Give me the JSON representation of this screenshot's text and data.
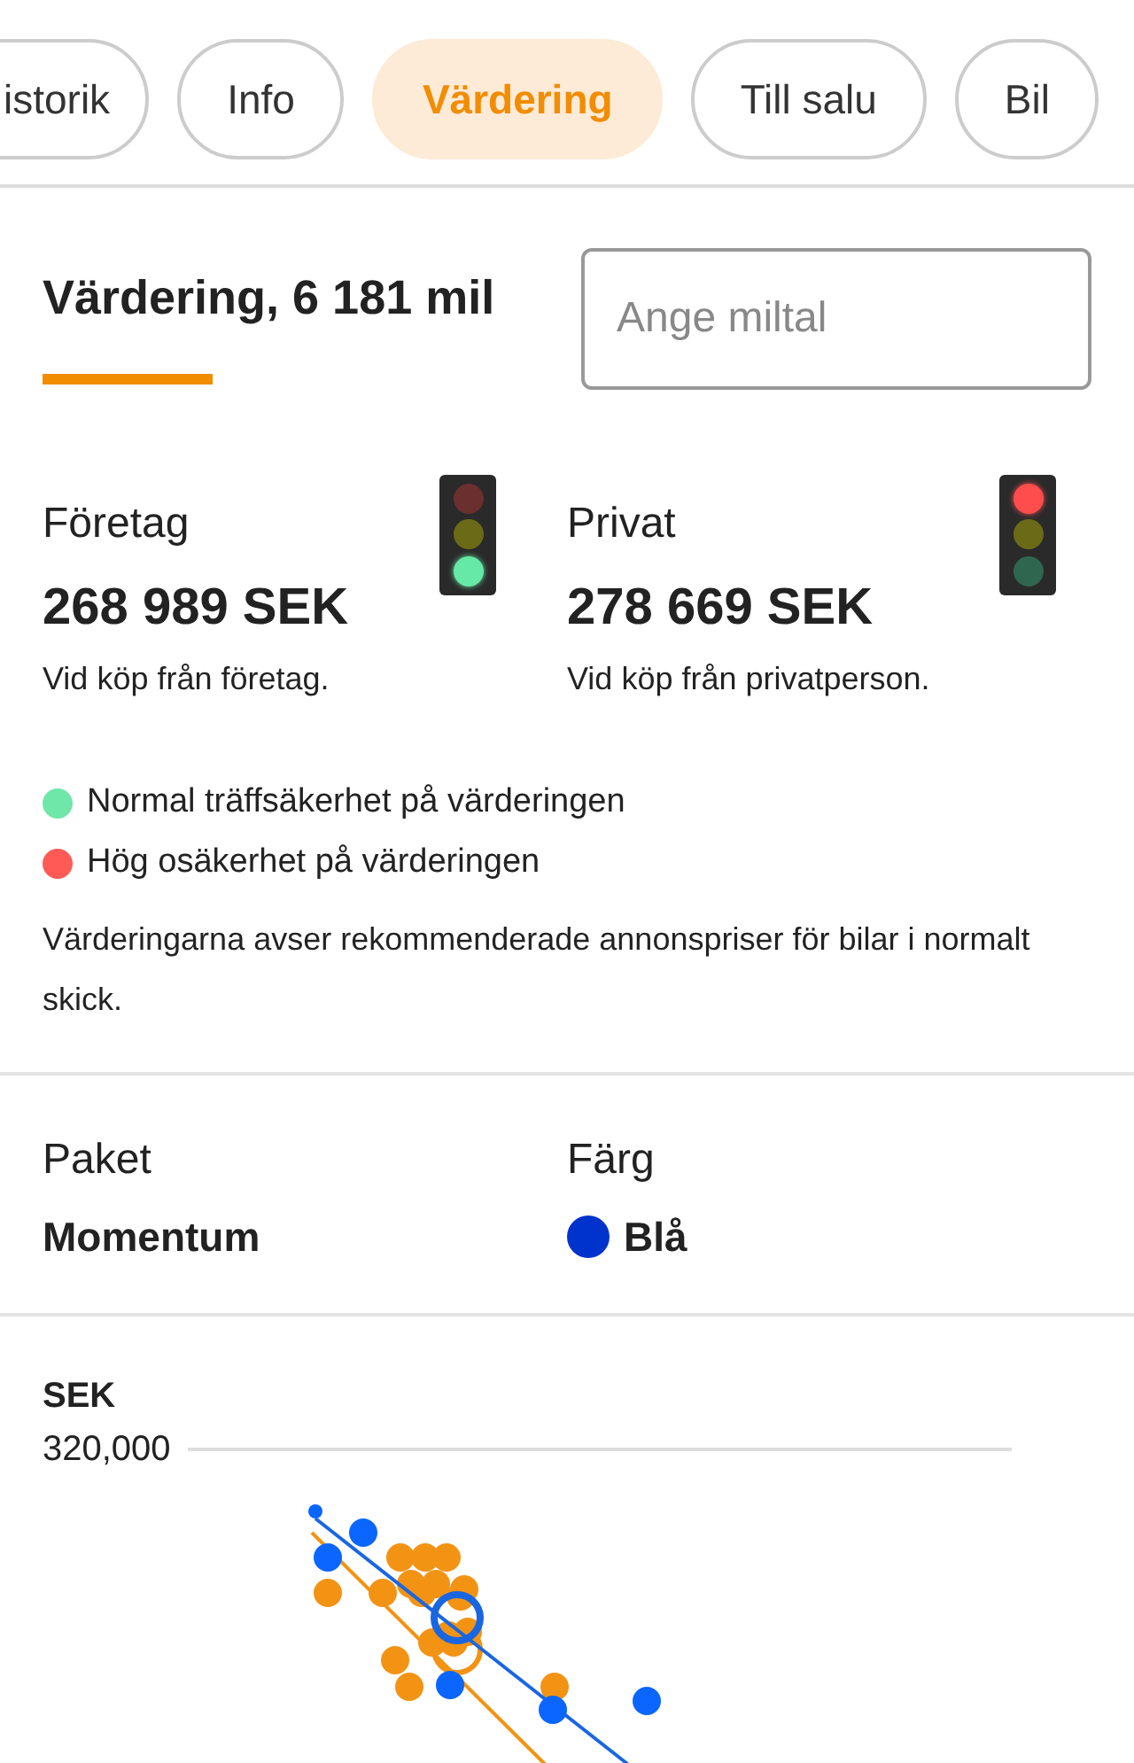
{
  "tabs": [
    {
      "label": "istorik",
      "selected": false
    },
    {
      "label": "Info",
      "selected": false
    },
    {
      "label": "Värdering",
      "selected": true
    },
    {
      "label": "Till salu",
      "selected": false
    },
    {
      "label": "Bil",
      "selected": false
    }
  ],
  "header": {
    "title": "Värdering, 6 181 mil",
    "mileage_field": {
      "placeholder": "Ange miltal"
    }
  },
  "valuations": [
    {
      "label": "Företag",
      "price": "268 989 SEK",
      "note": "Vid köp från företag.",
      "lamps": [
        {
          "on": false
        },
        {
          "on": false
        },
        {
          "on": true
        }
      ]
    },
    {
      "label": "Privat",
      "price": "278 669 SEK",
      "note": "Vid köp från privatperson.",
      "lamps": [
        {
          "on": true
        },
        {
          "on": false
        },
        {
          "on": false
        }
      ]
    }
  ],
  "legend": [
    {
      "text": "Normal träffsäkerhet på värderingen",
      "color": "#6ee7a8"
    },
    {
      "text": "Hög osäkerhet på värderingen",
      "color": "#ff5a55"
    }
  ],
  "disclaimer": "Värderingarna avser rekommenderade annonspriser för bilar i normalt skick.",
  "details": [
    {
      "label": "Paket",
      "value": "Momentum"
    },
    {
      "label": "Färg",
      "value": "Blå",
      "color": "#0033cc"
    }
  ],
  "chart": {
    "unit": "SEK",
    "tick_label": "320,000"
  }
}
